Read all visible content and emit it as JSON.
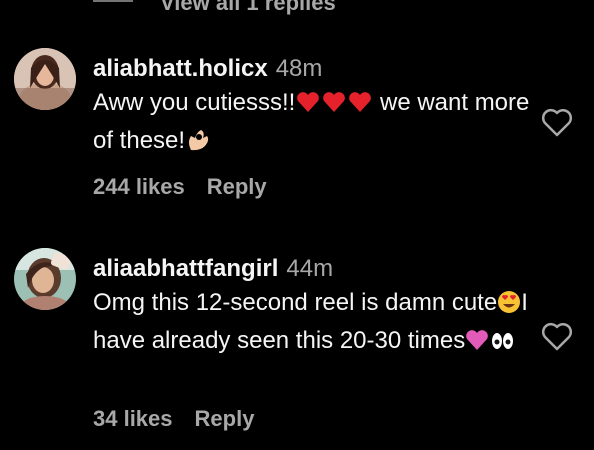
{
  "top": {
    "view_replies_label": "View all 1 replies"
  },
  "comments": [
    {
      "username": "aliabhatt.holicx",
      "time": "48m",
      "text_part1": "Aww you cutiesss!!",
      "text_part2": " we want more of these!",
      "emoji_1": "red-hearts",
      "emoji_2": "ok-hand",
      "likes": "244 likes",
      "reply_label": "Reply"
    },
    {
      "username": "aliaabhattfangirl",
      "time": "44m",
      "text_part1": "Omg this 12-second reel is damn cute",
      "text_part2": "I have already seen this 20-30 times",
      "emoji_1": "heart-eyes",
      "emoji_2": "pink-heart-and-eyes",
      "likes": "34 likes",
      "reply_label": "Reply"
    }
  ],
  "colors": {
    "background": "#000000",
    "primary_text": "#f5f5f5",
    "secondary_text": "#a8a8a8"
  }
}
